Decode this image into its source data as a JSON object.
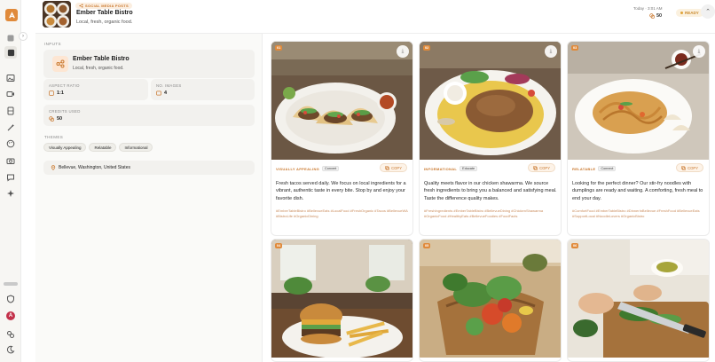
{
  "header": {
    "tag": "SOCIAL MEDIA POSTS",
    "title": "Ember Table Bistro",
    "subtitle": "Local, fresh, organic food.",
    "time": "Today · 3:01 AM",
    "credits": "50",
    "status": "READY",
    "collapse_icon": "chevron-up-icon"
  },
  "inputs": {
    "section_label": "INPUTS",
    "business_name": "Ember Table Bistro",
    "business_desc": "Local, fresh, organic food.",
    "aspect_ratio_label": "ASPECT RATIO",
    "aspect_ratio_value": "1:1",
    "num_images_label": "NO. IMAGES",
    "num_images_value": "4",
    "credits_used_label": "CREDITS USED",
    "credits_used_value": "50",
    "themes_label": "THEMES",
    "themes": [
      "Visually Appealing",
      "Relatable",
      "Informational"
    ],
    "location": "Bellevue, Washington, United States"
  },
  "cards": [
    {
      "num": "01",
      "type": "VISUALLY APPEALING",
      "goal": "Convert",
      "copy_label": "COPY",
      "caption": "Fresh tacos served daily. We focus on local ingredients for a vibrant, authentic taste in every bite. Stop by and enjoy your favorite dish.",
      "tags": "#EmberTableBistro #BellevueEats #LocalFood #FreshOrganic #Tacos #BellevueWA #BistroLife #OrganicDining"
    },
    {
      "num": "02",
      "type": "INFORMATIONAL",
      "goal": "Educate",
      "copy_label": "COPY",
      "caption": "Quality meets flavor in our chicken shawarma. We source fresh ingredients to bring you a balanced and satisfying meal. Taste the difference quality makes.",
      "tags": "#FreshIngredients #EmberTableBistro #BellevueDining #ChickenShawarma #OrganicFood #HealthyEats #BellevueFoodies #FoodFacts"
    },
    {
      "num": "03",
      "type": "RELATABLE",
      "goal": "Connect",
      "copy_label": "COPY",
      "caption": "Looking for the perfect dinner? Our stir-fry noodles with dumplings are ready and waiting. A comforting, fresh meal to end your day.",
      "tags": "#ComfortFood #EmberTableBistro #DinnerInBellevue #FreshFood #BellevueEats #SupportLocal #NoodleLovers #OrganicBistro"
    },
    {
      "num": "04"
    },
    {
      "num": "05"
    },
    {
      "num": "06"
    }
  ],
  "colors": {
    "accent": "#e08a3a",
    "accent_soft": "#fdf3e8",
    "tag_text": "#c98a5a"
  }
}
